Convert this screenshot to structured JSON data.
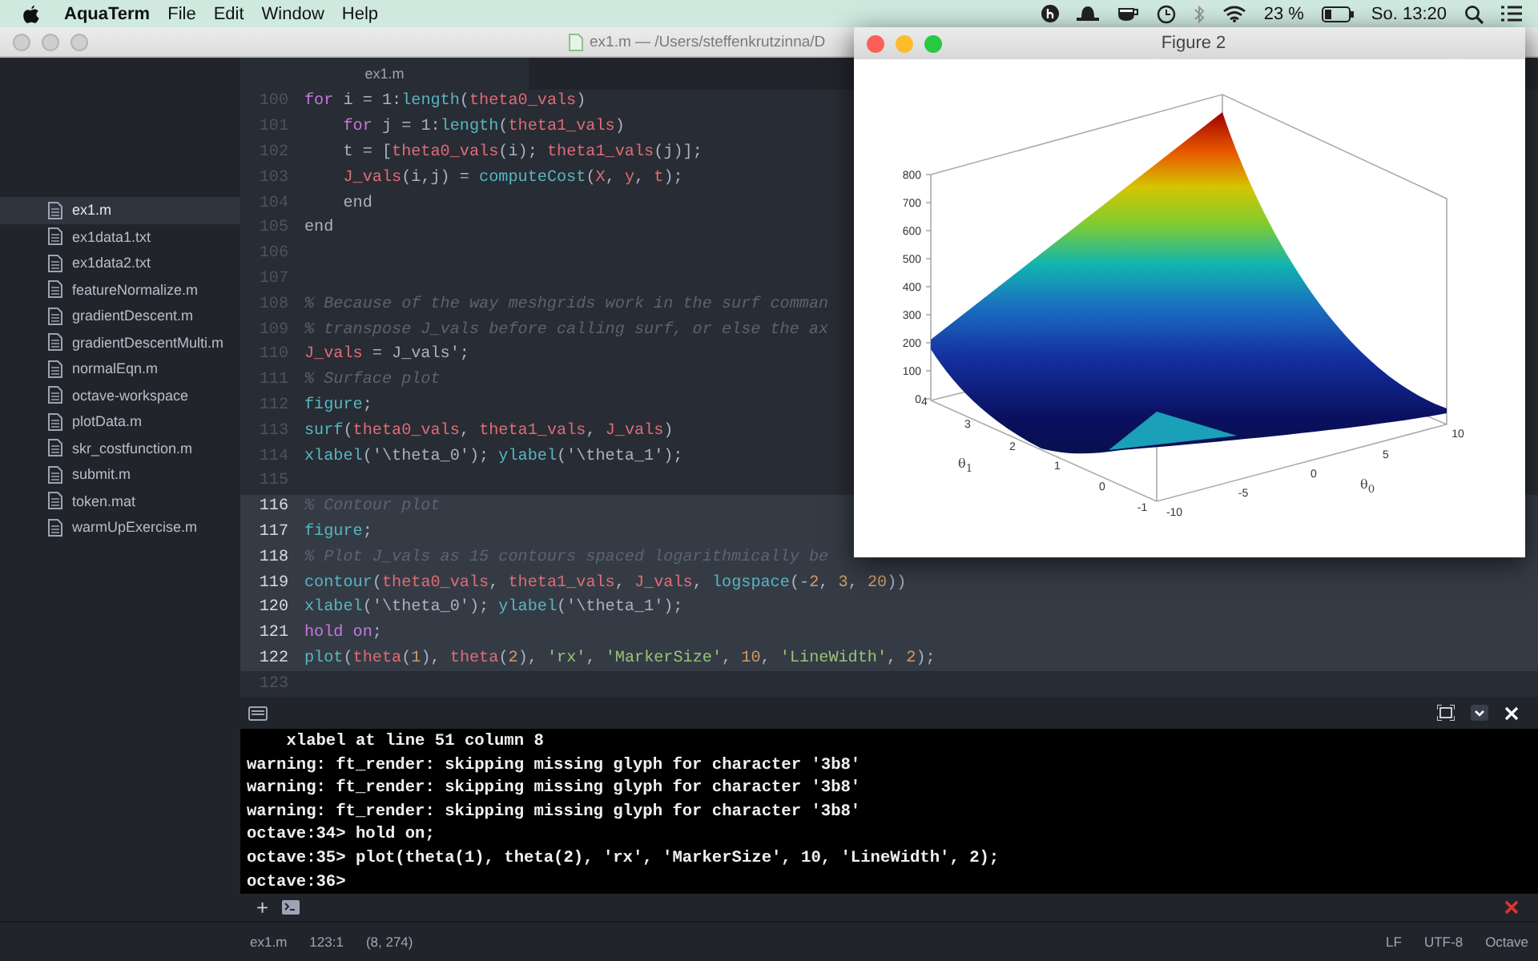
{
  "menubar": {
    "app_name": "AquaTerm",
    "menus": [
      "File",
      "Edit",
      "Window",
      "Help"
    ],
    "battery_percent": "23 %",
    "clock": "So. 13:20"
  },
  "editor_window": {
    "title": "ex1.m — /Users/steffenkrutzinna/D",
    "tab": "ex1.m"
  },
  "sidebar": {
    "files": [
      {
        "name": "ex1.m",
        "selected": true
      },
      {
        "name": "ex1data1.txt",
        "selected": false
      },
      {
        "name": "ex1data2.txt",
        "selected": false
      },
      {
        "name": "featureNormalize.m",
        "selected": false
      },
      {
        "name": "gradientDescent.m",
        "selected": false
      },
      {
        "name": "gradientDescentMulti.m",
        "selected": false
      },
      {
        "name": "normalEqn.m",
        "selected": false
      },
      {
        "name": "octave-workspace",
        "selected": false
      },
      {
        "name": "plotData.m",
        "selected": false
      },
      {
        "name": "skr_costfunction.m",
        "selected": false
      },
      {
        "name": "submit.m",
        "selected": false
      },
      {
        "name": "token.mat",
        "selected": false
      },
      {
        "name": "warmUpExercise.m",
        "selected": false
      }
    ]
  },
  "code": {
    "lines": [
      {
        "number": "100",
        "selected": false,
        "tokens": [
          {
            "text": "for",
            "kind": "keyword"
          },
          {
            "text": " i = 1:",
            "kind": "plain"
          },
          {
            "text": "length",
            "kind": "function"
          },
          {
            "text": "(",
            "kind": "plain"
          },
          {
            "text": "theta0_vals",
            "kind": "variable"
          },
          {
            "text": ")",
            "kind": "plain"
          }
        ]
      },
      {
        "number": "101",
        "selected": false,
        "tokens": [
          {
            "text": "    for",
            "kind": "keyword"
          },
          {
            "text": " j = 1:",
            "kind": "plain"
          },
          {
            "text": "length",
            "kind": "function"
          },
          {
            "text": "(",
            "kind": "plain"
          },
          {
            "text": "theta1_vals",
            "kind": "variable"
          },
          {
            "text": ")",
            "kind": "plain"
          }
        ]
      },
      {
        "number": "102",
        "selected": false,
        "tokens": [
          {
            "text": "    t = [",
            "kind": "plain"
          },
          {
            "text": "theta0_vals",
            "kind": "variable"
          },
          {
            "text": "(i); ",
            "kind": "plain"
          },
          {
            "text": "theta1_vals",
            "kind": "variable"
          },
          {
            "text": "(j)];",
            "kind": "plain"
          }
        ]
      },
      {
        "number": "103",
        "selected": false,
        "tokens": [
          {
            "text": "    J_vals",
            "kind": "variable"
          },
          {
            "text": "(i,j) = ",
            "kind": "plain"
          },
          {
            "text": "computeCost",
            "kind": "function"
          },
          {
            "text": "(",
            "kind": "plain"
          },
          {
            "text": "X",
            "kind": "variable"
          },
          {
            "text": ", ",
            "kind": "plain"
          },
          {
            "text": "y",
            "kind": "variable"
          },
          {
            "text": ", ",
            "kind": "plain"
          },
          {
            "text": "t",
            "kind": "variable"
          },
          {
            "text": ");",
            "kind": "plain"
          }
        ]
      },
      {
        "number": "104",
        "selected": false,
        "tokens": [
          {
            "text": "    end",
            "kind": "plain"
          }
        ]
      },
      {
        "number": "105",
        "selected": false,
        "tokens": [
          {
            "text": "end",
            "kind": "plain"
          }
        ]
      },
      {
        "number": "106",
        "selected": false
      },
      {
        "number": "107",
        "selected": false
      },
      {
        "number": "108",
        "selected": false,
        "tokens": [
          {
            "text": "% Because of the way meshgrids work in the surf comman",
            "kind": "comment"
          }
        ]
      },
      {
        "number": "109",
        "selected": false,
        "tokens": [
          {
            "text": "% transpose J_vals before calling surf, or else the ax",
            "kind": "comment"
          }
        ]
      },
      {
        "number": "110",
        "selected": false,
        "tokens": [
          {
            "text": "J_vals",
            "kind": "variable"
          },
          {
            "text": " = J_vals';",
            "kind": "plain"
          }
        ]
      },
      {
        "number": "111",
        "selected": false,
        "tokens": [
          {
            "text": "% Surface plot",
            "kind": "comment"
          }
        ]
      },
      {
        "number": "112",
        "selected": false,
        "tokens": [
          {
            "text": "figure",
            "kind": "function"
          },
          {
            "text": ";",
            "kind": "plain"
          }
        ]
      },
      {
        "number": "113",
        "selected": false,
        "tokens": [
          {
            "text": "surf",
            "kind": "function"
          },
          {
            "text": "(",
            "kind": "plain"
          },
          {
            "text": "theta0_vals",
            "kind": "variable"
          },
          {
            "text": ", ",
            "kind": "plain"
          },
          {
            "text": "theta1_vals",
            "kind": "variable"
          },
          {
            "text": ", ",
            "kind": "plain"
          },
          {
            "text": "J_vals",
            "kind": "variable"
          },
          {
            "text": ")",
            "kind": "plain"
          }
        ]
      },
      {
        "number": "114",
        "selected": false,
        "tokens": [
          {
            "text": "xlabel",
            "kind": "function"
          },
          {
            "text": "('\\theta_0'); ",
            "kind": "plain"
          },
          {
            "text": "ylabel",
            "kind": "function"
          },
          {
            "text": "('\\theta_1');",
            "kind": "plain"
          }
        ]
      },
      {
        "number": "115",
        "selected": false
      },
      {
        "number": "116",
        "selected": true,
        "tokens": [
          {
            "text": "% Contour plot",
            "kind": "comment"
          }
        ]
      },
      {
        "number": "117",
        "selected": true,
        "tokens": [
          {
            "text": "figure",
            "kind": "function"
          },
          {
            "text": ";",
            "kind": "plain"
          }
        ]
      },
      {
        "number": "118",
        "selected": true,
        "tokens": [
          {
            "text": "% Plot J_vals as 15 contours spaced logarithmically be",
            "kind": "comment"
          }
        ]
      },
      {
        "number": "119",
        "selected": true,
        "tokens": [
          {
            "text": "contour",
            "kind": "function"
          },
          {
            "text": "(",
            "kind": "plain"
          },
          {
            "text": "theta0_vals",
            "kind": "variable"
          },
          {
            "text": ", ",
            "kind": "plain"
          },
          {
            "text": "theta1_vals",
            "kind": "variable"
          },
          {
            "text": ", ",
            "kind": "plain"
          },
          {
            "text": "J_vals",
            "kind": "variable"
          },
          {
            "text": ", ",
            "kind": "plain"
          },
          {
            "text": "logspace",
            "kind": "function"
          },
          {
            "text": "(-",
            "kind": "plain"
          },
          {
            "text": "2",
            "kind": "number"
          },
          {
            "text": ", ",
            "kind": "plain"
          },
          {
            "text": "3",
            "kind": "number"
          },
          {
            "text": ", ",
            "kind": "plain"
          },
          {
            "text": "20",
            "kind": "number"
          },
          {
            "text": "))",
            "kind": "plain"
          }
        ]
      },
      {
        "number": "120",
        "selected": true,
        "tokens": [
          {
            "text": "xlabel",
            "kind": "function"
          },
          {
            "text": "('\\theta_0'); ",
            "kind": "plain"
          },
          {
            "text": "ylabel",
            "kind": "function"
          },
          {
            "text": "('\\theta_1');",
            "kind": "plain"
          }
        ]
      },
      {
        "number": "121",
        "selected": true,
        "tokens": [
          {
            "text": "hold on",
            "kind": "keyword"
          },
          {
            "text": ";",
            "kind": "plain"
          }
        ]
      },
      {
        "number": "122",
        "selected": true,
        "tokens": [
          {
            "text": "plot",
            "kind": "function"
          },
          {
            "text": "(",
            "kind": "plain"
          },
          {
            "text": "theta",
            "kind": "variable"
          },
          {
            "text": "(",
            "kind": "plain"
          },
          {
            "text": "1",
            "kind": "number"
          },
          {
            "text": "), ",
            "kind": "plain"
          },
          {
            "text": "theta",
            "kind": "variable"
          },
          {
            "text": "(",
            "kind": "plain"
          },
          {
            "text": "2",
            "kind": "number"
          },
          {
            "text": "), ",
            "kind": "plain"
          },
          {
            "text": "'rx'",
            "kind": "string"
          },
          {
            "text": ", ",
            "kind": "plain"
          },
          {
            "text": "'MarkerSize'",
            "kind": "string"
          },
          {
            "text": ", ",
            "kind": "plain"
          },
          {
            "text": "10",
            "kind": "number"
          },
          {
            "text": ", ",
            "kind": "plain"
          },
          {
            "text": "'LineWidth'",
            "kind": "string"
          },
          {
            "text": ", ",
            "kind": "plain"
          },
          {
            "text": "2",
            "kind": "number"
          },
          {
            "text": ");",
            "kind": "plain"
          }
        ]
      },
      {
        "number": "123",
        "selected": false
      }
    ]
  },
  "figure_window": {
    "title": "Figure 2",
    "z_ticks": [
      "800",
      "700",
      "600",
      "500",
      "400",
      "300",
      "200",
      "100",
      "0"
    ],
    "theta1_ticks": [
      "4",
      "3",
      "2",
      "1",
      "0",
      "-1"
    ],
    "theta0_ticks": [
      "-10",
      "-5",
      "0",
      "5",
      "10"
    ],
    "theta1_label": "θ$_{1}$",
    "theta0_label": "θ$_{0}$"
  },
  "console": {
    "lines": [
      "    xlabel at line 51 column 8",
      "warning: ft_render: skipping missing glyph for character '3b8'",
      "warning: ft_render: skipping missing glyph for character '3b8'",
      "warning: ft_render: skipping missing glyph for character '3b8'",
      "octave:34> hold on;",
      "octave:35> plot(theta(1), theta(2), 'rx', 'MarkerSize', 10, 'LineWidth', 2);",
      "octave:36>"
    ],
    "new_tab": "+"
  },
  "status_bar": {
    "file": "ex1.m",
    "cursor": "123:1",
    "selection": "(8, 274)",
    "line_ending": "LF",
    "encoding": "UTF-8",
    "grammar": "Octave"
  }
}
